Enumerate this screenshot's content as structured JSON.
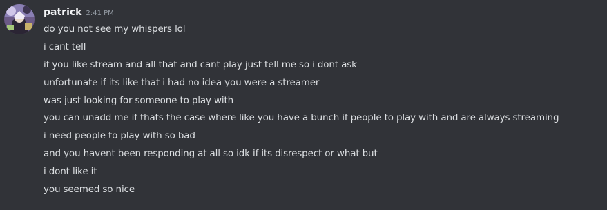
{
  "author": {
    "username": "patrick",
    "timestamp": "2:41 PM",
    "avatar_icon": "user-avatar-icon"
  },
  "messages": [
    "do you not see my whispers lol",
    "i cant tell",
    "if you like stream and all that and cant play just tell me so i dont ask",
    "unfortunate if its like that i had no idea you were a streamer",
    "was just looking for someone to play with",
    "you can unadd me if thats the case where like you have a bunch if people to play with and are always streaming",
    "i need people to play with so bad",
    "and you havent been responding at all so idk if its disrespect or what but",
    "i dont like it",
    "you seemed so nice"
  ],
  "colors": {
    "background": "#313338",
    "username": "#f2f3f5",
    "message_text": "#dbdee1",
    "timestamp": "#949ba4"
  }
}
